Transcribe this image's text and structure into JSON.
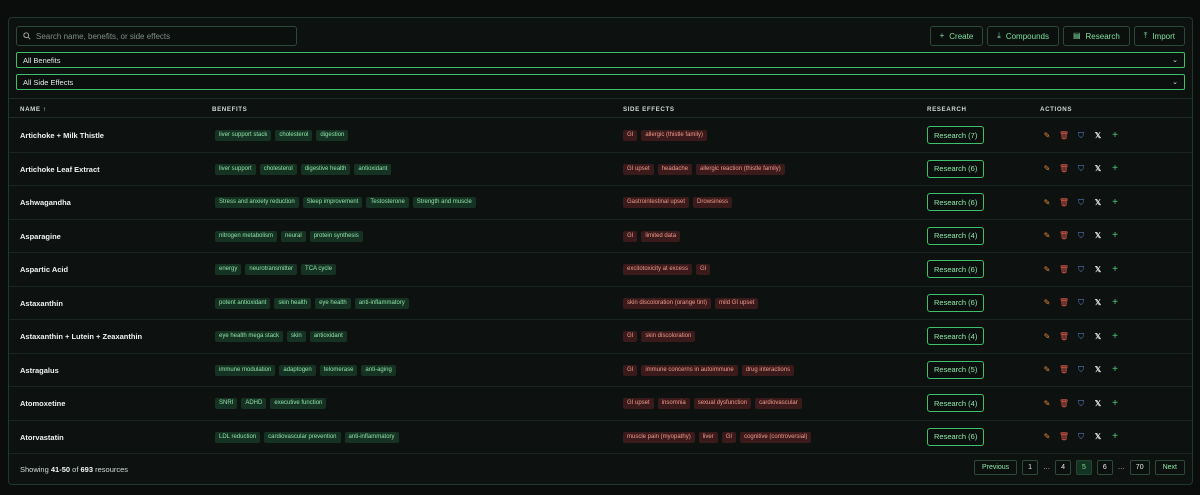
{
  "search": {
    "placeholder": "Search name, benefits, or side effects",
    "value": ""
  },
  "toolbar": {
    "create": {
      "icon": "plus-icon",
      "label": "Create"
    },
    "compounds": {
      "icon": "download-icon",
      "label": "Compounds"
    },
    "research": {
      "icon": "document-icon",
      "label": "Research"
    },
    "import": {
      "icon": "upload-icon",
      "label": "Import"
    }
  },
  "filters": {
    "benefits": "All Benefits",
    "side_effects": "All Side Effects"
  },
  "table": {
    "headers": {
      "name": "NAME ↑",
      "benefits": "BENEFITS",
      "side_effects": "SIDE EFFECTS",
      "research": "RESEARCH",
      "actions": "ACTIONS"
    },
    "rows": [
      {
        "name": "Artichoke + Milk Thistle",
        "benefits": [
          "liver support stack",
          "cholesterol",
          "digestion"
        ],
        "side_effects": [
          "GI",
          "allergic (thistle family)"
        ],
        "research": "Research (7)"
      },
      {
        "name": "Artichoke Leaf Extract",
        "benefits": [
          "liver support",
          "cholesterol",
          "digestive health",
          "antioxidant"
        ],
        "side_effects": [
          "GI upset",
          "headache",
          "allergic reaction (thistle family)"
        ],
        "research": "Research (6)"
      },
      {
        "name": "Ashwagandha",
        "benefits": [
          "Stress and anxiety reduction",
          "Sleep improvement",
          "Testosterone",
          "Strength and muscle"
        ],
        "side_effects": [
          "Gastrointestinal upset",
          "Drowsiness"
        ],
        "research": "Research (6)"
      },
      {
        "name": "Asparagine",
        "benefits": [
          "nitrogen metabolism",
          "neural",
          "protein synthesis"
        ],
        "side_effects": [
          "GI",
          "limited data"
        ],
        "research": "Research (4)"
      },
      {
        "name": "Aspartic Acid",
        "benefits": [
          "energy",
          "neurotransmitter",
          "TCA cycle"
        ],
        "side_effects": [
          "excitotoxicity at excess",
          "GI"
        ],
        "research": "Research (6)"
      },
      {
        "name": "Astaxanthin",
        "benefits": [
          "potent antioxidant",
          "skin health",
          "eye health",
          "anti-inflammatory"
        ],
        "side_effects": [
          "skin discoloration (orange tint)",
          "mild GI upset"
        ],
        "research": "Research (6)"
      },
      {
        "name": "Astaxanthin + Lutein + Zeaxanthin",
        "benefits": [
          "eye health mega stack",
          "skin",
          "antioxidant"
        ],
        "side_effects": [
          "GI",
          "skin discoloration"
        ],
        "research": "Research (4)"
      },
      {
        "name": "Astragalus",
        "benefits": [
          "immune modulation",
          "adaptogen",
          "telomerase",
          "anti-aging"
        ],
        "side_effects": [
          "GI",
          "immune concerns in autoimmune",
          "drug interactions"
        ],
        "research": "Research (5)"
      },
      {
        "name": "Atomoxetine",
        "benefits": [
          "SNRI",
          "ADHD",
          "executive function"
        ],
        "side_effects": [
          "GI upset",
          "insomnia",
          "sexual dysfunction",
          "cardiovascular"
        ],
        "research": "Research (4)"
      },
      {
        "name": "Atorvastatin",
        "benefits": [
          "LDL reduction",
          "cardiovascular prevention",
          "anti-inflammatory"
        ],
        "side_effects": [
          "muscle pain (myopathy)",
          "liver",
          "GI",
          "cognitive (controversial)"
        ],
        "research": "Research (6)"
      }
    ],
    "action_icons": [
      "edit-icon",
      "trash-icon",
      "bookmark-icon",
      "x-icon",
      "plus-icon"
    ]
  },
  "footer": {
    "showing_prefix": "Showing",
    "range": "41-50",
    "of_word": "of",
    "total": "693",
    "suffix": "resources"
  },
  "pagination": {
    "previous": "Previous",
    "pages": [
      "1",
      "…",
      "4",
      "5",
      "6",
      "…",
      "70"
    ],
    "current": "5",
    "next": "Next"
  },
  "colors": {
    "accent": "#3fbf6a",
    "benefit_tag_bg": "#153222",
    "side_effect_tag_bg": "#3a1a1a",
    "edit": "#e08a3a",
    "delete": "#e05a4c",
    "bookmark": "#5f8fe0"
  }
}
